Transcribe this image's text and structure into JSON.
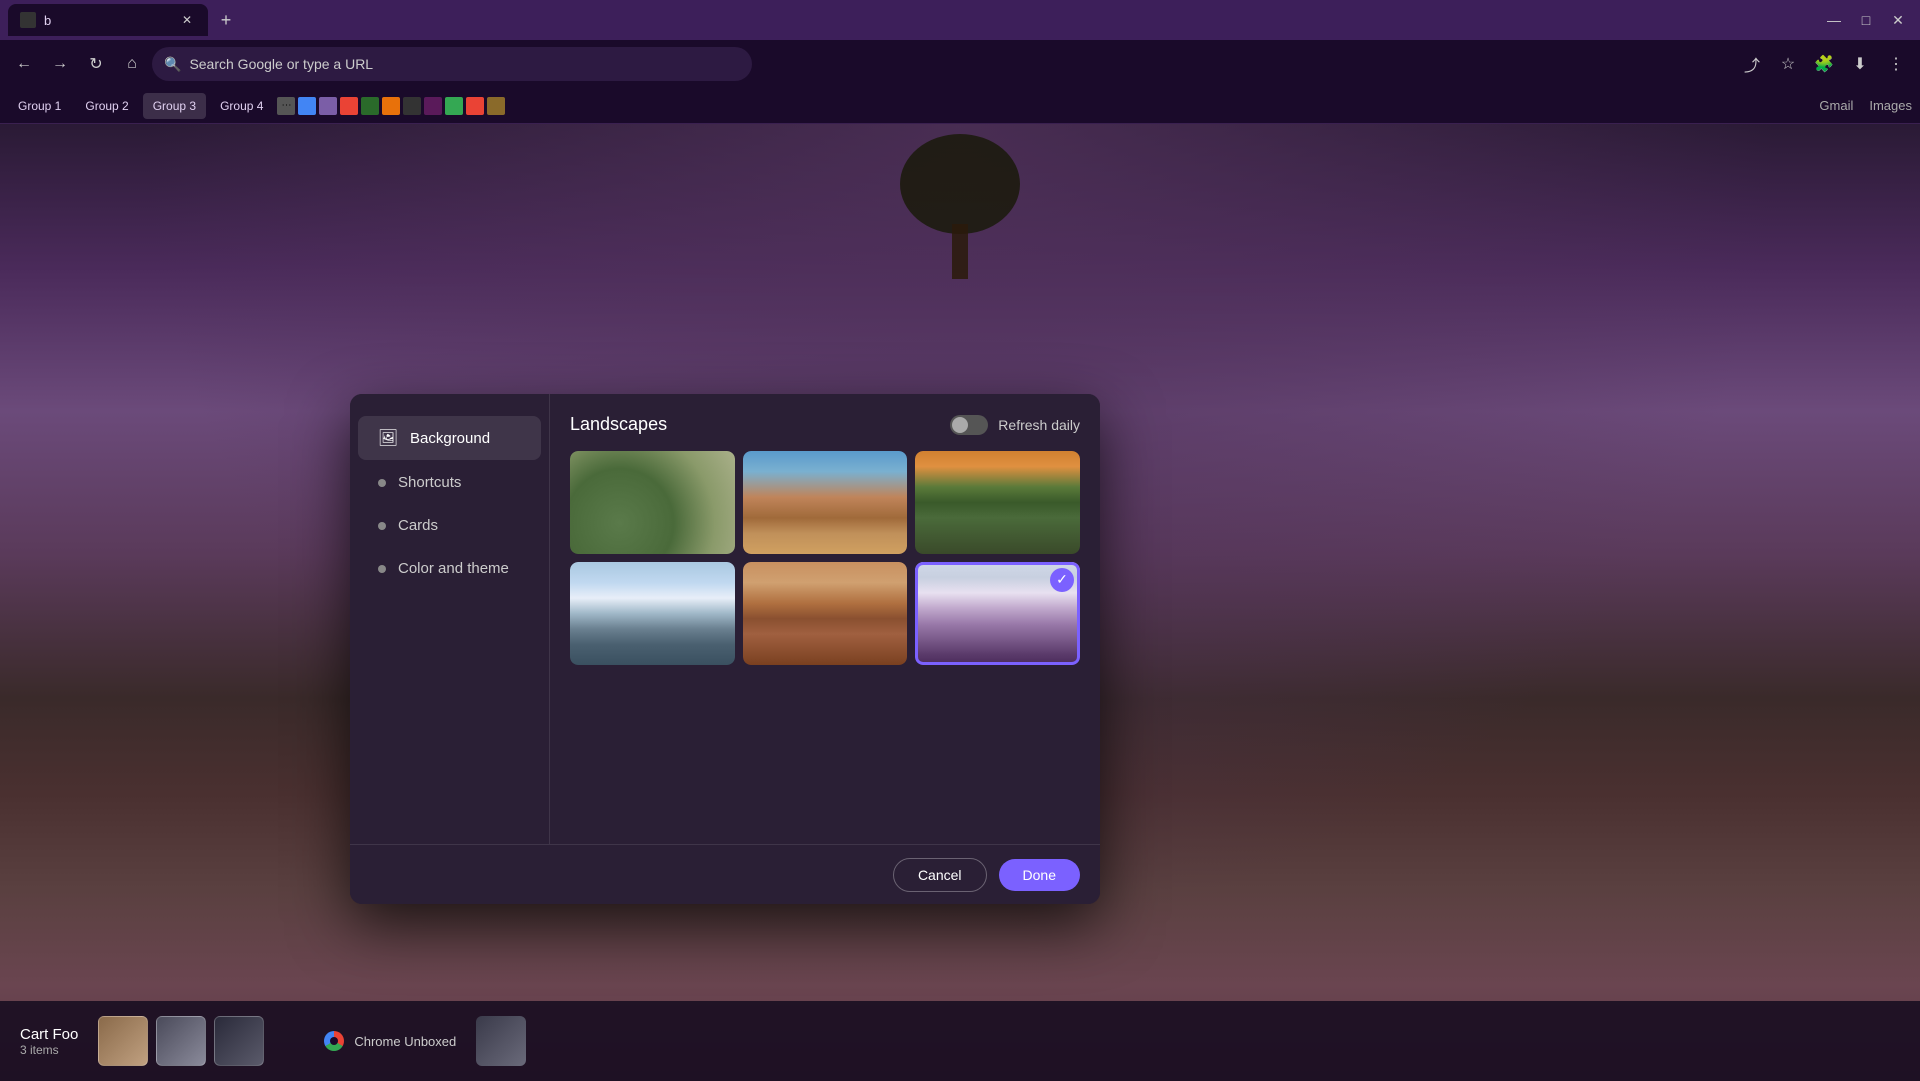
{
  "browser": {
    "tab_title": "b",
    "new_tab_label": "+",
    "search_placeholder": "Search Google or type a URL",
    "bookmark_groups": [
      {
        "label": "Group 1",
        "active": false
      },
      {
        "label": "Group 2",
        "active": false
      },
      {
        "label": "Group 3",
        "active": true
      },
      {
        "label": "Group 4",
        "active": false
      }
    ],
    "top_right_links": [
      "Gmail",
      "Images"
    ]
  },
  "dialog": {
    "sidebar": {
      "items": [
        {
          "label": "Background",
          "icon": "🖼",
          "active": true
        },
        {
          "label": "Shortcuts",
          "active": false
        },
        {
          "label": "Cards",
          "active": false
        },
        {
          "label": "Color and theme",
          "active": false
        }
      ]
    },
    "content": {
      "title": "Landscapes",
      "refresh_label": "Refresh daily",
      "images": [
        {
          "id": "rocks",
          "selected": false,
          "alt": "Rocky river landscape"
        },
        {
          "id": "arch",
          "selected": false,
          "alt": "Desert arch"
        },
        {
          "id": "cliffs",
          "selected": false,
          "alt": "Green cliffs at sunset"
        },
        {
          "id": "mountains",
          "selected": false,
          "alt": "Snowy mountains"
        },
        {
          "id": "desert-canyon",
          "selected": false,
          "alt": "Desert canyon"
        },
        {
          "id": "lavender",
          "selected": true,
          "alt": "Lavender field with tree"
        }
      ]
    },
    "footer": {
      "cancel_label": "Cancel",
      "done_label": "Done"
    }
  },
  "cart_footer": {
    "title": "Cart Foo",
    "count": "3 items",
    "chrome_unboxed_label": "Chrome Unboxed"
  },
  "window_controls": {
    "minimize": "—",
    "maximize": "□",
    "close": "✕"
  }
}
